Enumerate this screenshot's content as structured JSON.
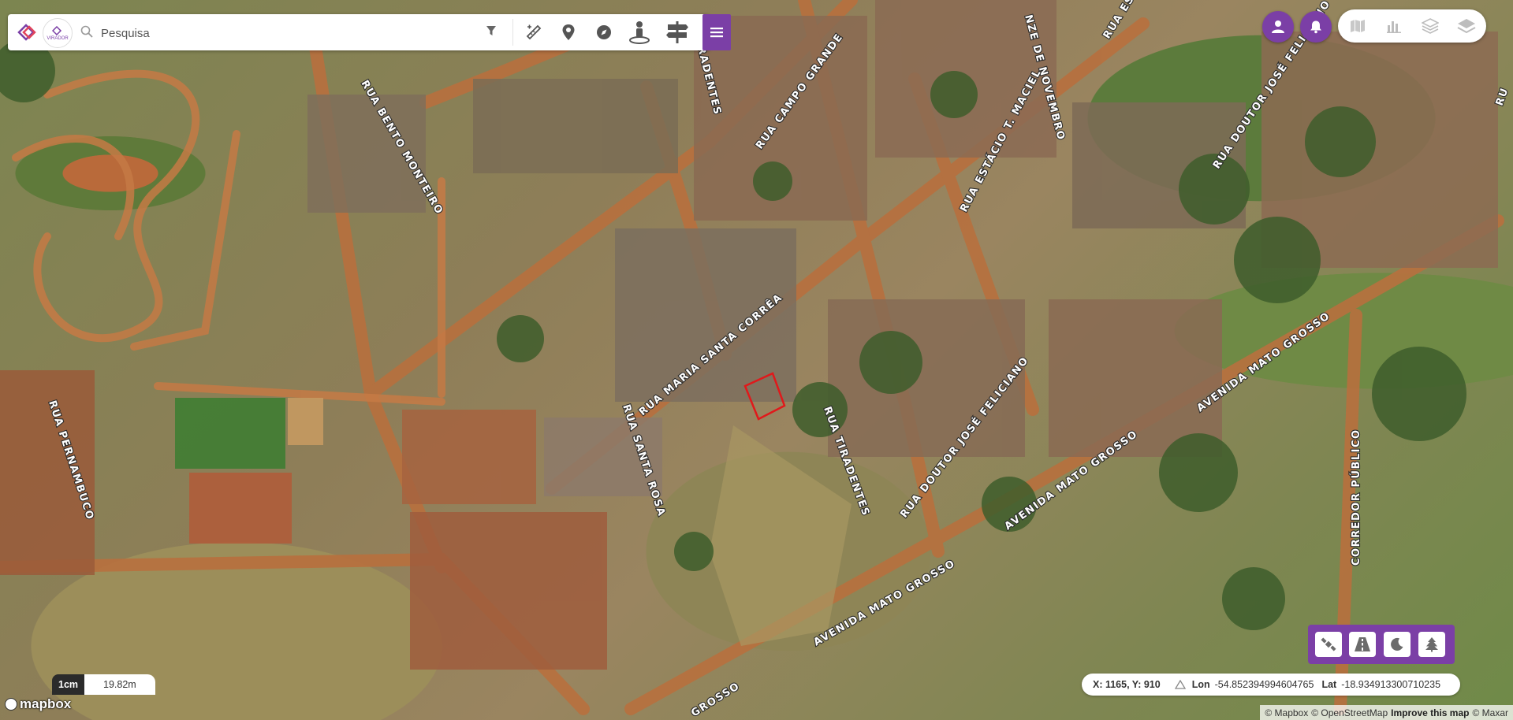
{
  "search": {
    "placeholder": "Pesquisa",
    "value": ""
  },
  "logo": {
    "brand_text": "VIRADOR"
  },
  "icons": {
    "logo": "logo-icon",
    "search": "search-icon",
    "filter": "filter-icon",
    "measure": "measure-tool-icon",
    "marker": "location-pin-icon",
    "compass": "compass-icon",
    "street_view": "street-view-icon",
    "signpost": "signpost-icon",
    "menu": "hamburger-menu-icon",
    "user": "user-icon",
    "bell": "bell-icon",
    "map_layer": "map-icon",
    "chart": "bar-chart-icon",
    "layers_outline": "layers-outline-icon",
    "layers": "layers-icon",
    "satellite": "satellite-icon",
    "road": "road-icon",
    "night": "moon-icon",
    "nature": "tree-icon",
    "warning": "warning-icon"
  },
  "colors": {
    "accent": "#7b3fa6",
    "selection_outline": "#e0191b"
  },
  "streets": [
    "RUA BENTO MONTEIRO",
    "RUA CAMPO GRANDE",
    "RADENTES",
    "NZE DE NOVEMBRO",
    "RUA ESTÁCIO T. MACIEL",
    "RUA DOUTOR JOSÉ FELICIANO",
    "RUA PERNAMBUCO",
    "RUA MARIA SANTA CORRÊA",
    "RUA SANTA ROSA",
    "RUA TIRADENTES",
    "RUA DOUTOR JOSÉ FELICIANO",
    "AVENIDA MATO GROSSO",
    "AVENIDA MATO GROSSO",
    "AVENIDA MATO GROSSO",
    "CORREDOR PÚBLICO",
    "GROSSO",
    "RUA ES",
    "RU"
  ],
  "coordinates": {
    "xy_text": "X: 1165, Y: 910",
    "lon_label": "Lon",
    "lon_value": "-54.852394994604765",
    "lat_label": "Lat",
    "lat_value": "-18.934913300710235"
  },
  "scale": {
    "unit": "1cm",
    "value": "19.82m"
  },
  "mapbox_logo": "mapbox",
  "attribution": {
    "mapbox": "© Mapbox",
    "osm": "© OpenStreetMap",
    "improve": "Improve this map",
    "maxar": "© Maxar"
  }
}
